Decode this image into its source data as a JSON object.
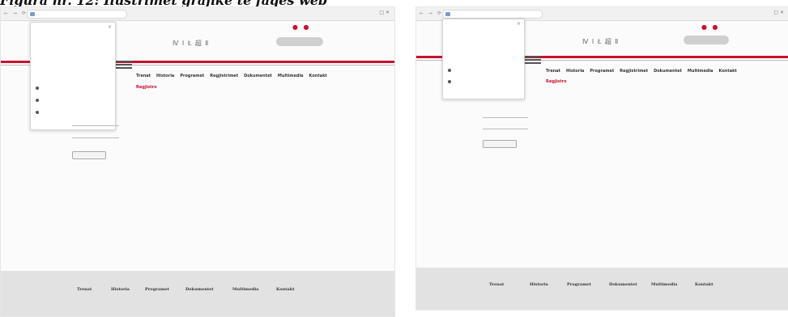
{
  "caption": "Figura nr. 12: Ilustrimet grafike te faqes web",
  "screenshots": [
    {
      "url": "",
      "nav": "← → ⟳",
      "window_controls": "□ ✕",
      "logo": "Ⅳ Ⅰ Ł 超 Ⅱ",
      "logo_sub": "",
      "menu": [
        "Trenat",
        "Historia",
        "Programet",
        "Regjistrimet",
        "Dokumentet",
        "Multimedia",
        "Kontakt"
      ],
      "submenu": "Regjistro",
      "popup": {
        "title": "",
        "close": "×",
        "text": "",
        "items": [
          "",
          "",
          ""
        ]
      },
      "form": {
        "intro": "",
        "field1": "",
        "field2": "",
        "button": ""
      },
      "footer": {
        "headings": [
          "Trenat",
          "Historia",
          "Programet",
          "Dokumentet",
          "Multimedia",
          "Kontakt"
        ]
      }
    },
    {
      "url": "",
      "nav": "← → ⟳",
      "window_controls": "□ ✕",
      "logo": "Ⅳ Ⅰ Ł 超 Ⅱ",
      "logo_sub": "",
      "menu": [
        "Trenat",
        "Historia",
        "Programet",
        "Regjistrimet",
        "Dokumentet",
        "Multimedia",
        "Kontakt"
      ],
      "submenu": "Regjistro",
      "popup": {
        "title": "",
        "close": "×",
        "text": "",
        "items": [
          "",
          ""
        ]
      },
      "form": {
        "intro": "",
        "field1": "",
        "field2": "",
        "button": ""
      },
      "footer": {
        "headings": [
          "Trenat",
          "Historia",
          "Programet",
          "Dokumentet",
          "Multimedia",
          "Kontakt"
        ]
      }
    }
  ],
  "colors": {
    "accent": "#c8102e",
    "footer_bg": "#e2e2e2"
  },
  "icons": [
    "lock-icon",
    "bullet-icon",
    "close-icon"
  ]
}
